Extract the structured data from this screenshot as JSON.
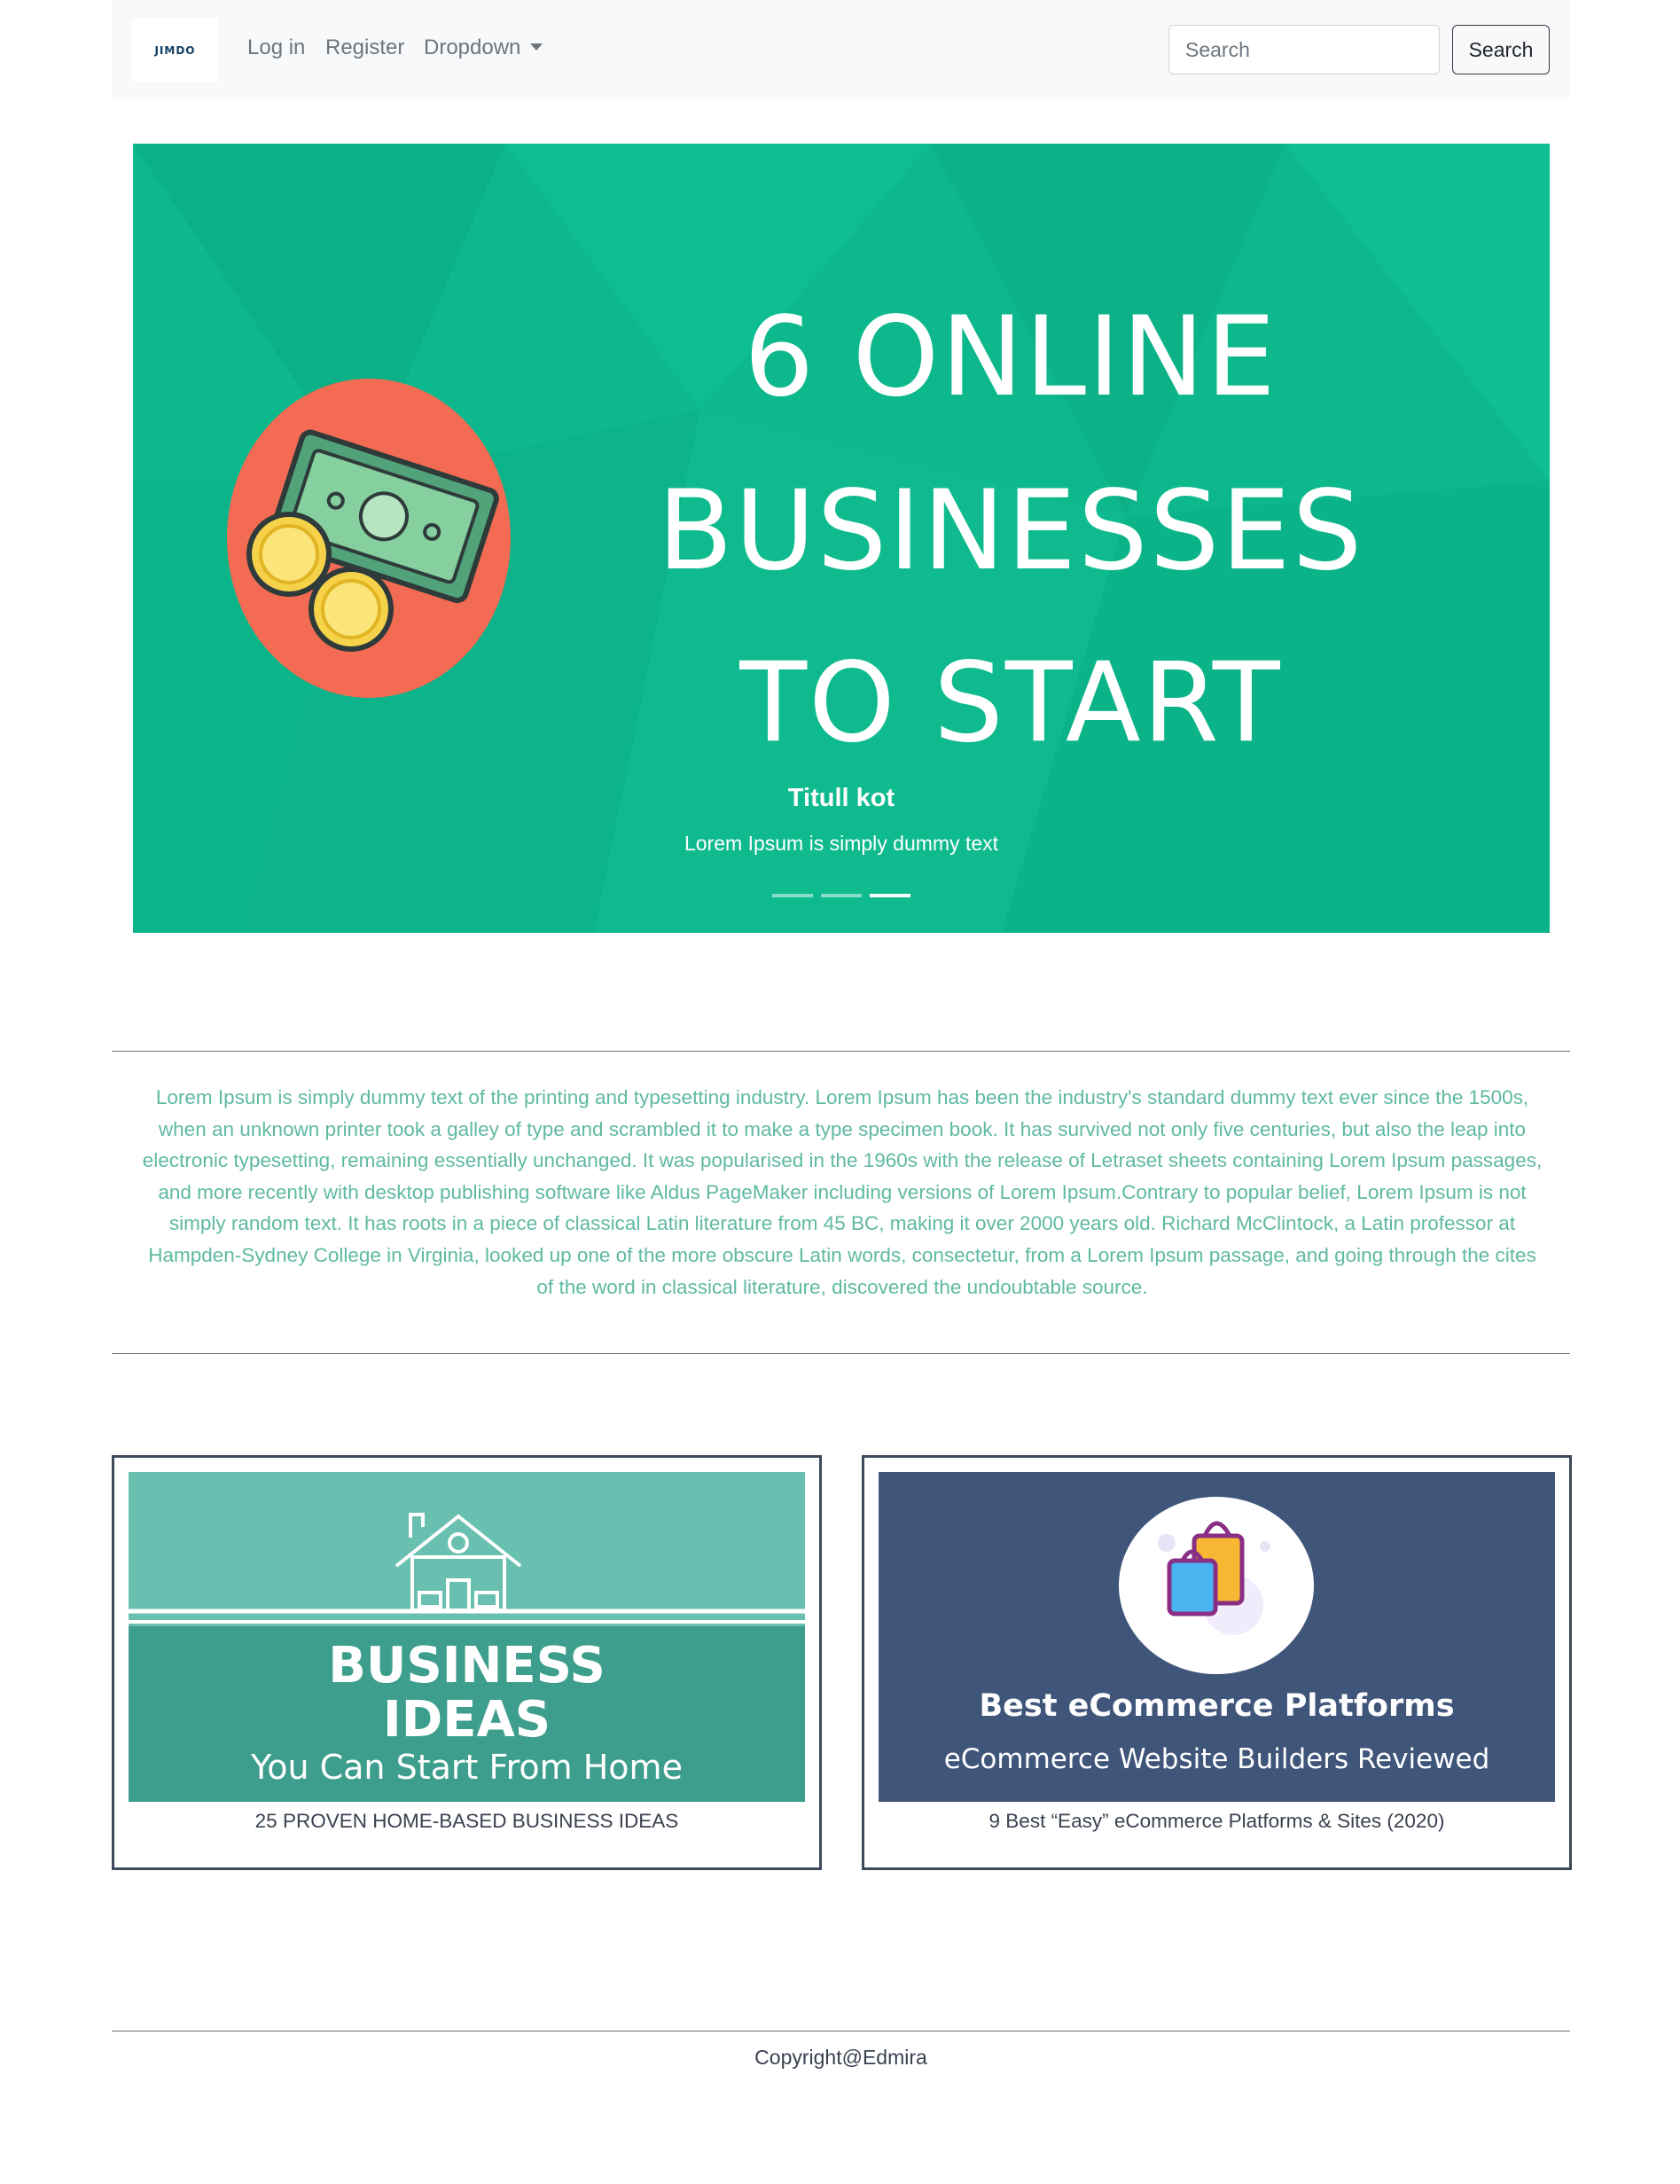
{
  "navbar": {
    "brand": "JIMDO",
    "links": [
      {
        "label": "Log in"
      },
      {
        "label": "Register"
      },
      {
        "label": "Dropdown"
      }
    ],
    "search": {
      "placeholder": "Search",
      "button_label": "Search"
    }
  },
  "carousel": {
    "slide_image_text": [
      "6 ONLINE",
      "BUSINESSES",
      "TO START"
    ],
    "caption_title": "Titull kot",
    "caption_text": "Lorem Ipsum is simply dummy text",
    "active_slide": 3,
    "slide_count": 3,
    "colors": {
      "background": "#0db88c",
      "circle": "#f26b52"
    }
  },
  "intro_paragraph": "Lorem Ipsum is simply dummy text of the printing and typesetting industry. Lorem Ipsum has been the industry's standard dummy text ever since the 1500s, when an unknown printer took a galley of type and scrambled it to make a type specimen book. It has survived not only five centuries, but also the leap into electronic typesetting, remaining essentially unchanged. It was popularised in the 1960s with the release of Letraset sheets containing Lorem Ipsum passages, and more recently with desktop publishing software like Aldus PageMaker including versions of Lorem Ipsum.Contrary to popular belief, Lorem Ipsum is not simply random text. It has roots in a piece of classical Latin literature from 45 BC, making it over 2000 years old. Richard McClintock, a Latin professor at Hampden-Sydney College in Virginia, looked up one of the more obscure Latin words, consectetur, from a Lorem Ipsum passage, and going through the cites of the word in classical literature, discovered the undoubtable source.",
  "cards": [
    {
      "image_lines": [
        "BUSINESS",
        "IDEAS",
        "You Can Start From Home"
      ],
      "caption": "25 PROVEN HOME-BASED BUSINESS IDEAS",
      "colors": {
        "top": "#69bfb0",
        "bottom": "#3e9e8d"
      }
    },
    {
      "image_lines": [
        "Best eCommerce Platforms",
        "eCommerce Website Builders Reviewed"
      ],
      "caption": "9 Best “Easy” eCommerce Platforms & Sites (2020)",
      "colors": {
        "background": "#3f557a"
      }
    }
  ],
  "footer": {
    "text": "Copyright@Edmira"
  }
}
